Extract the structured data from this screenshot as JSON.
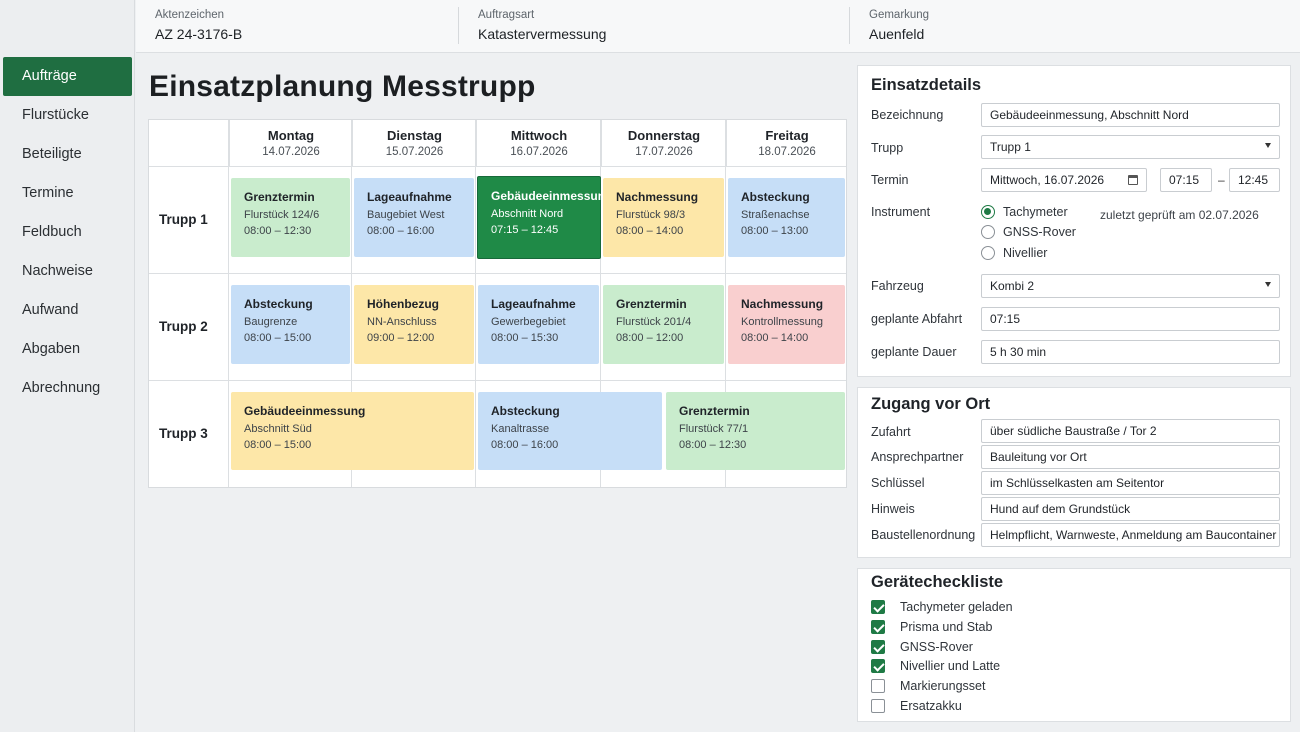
{
  "sidebar": {
    "items": [
      {
        "label": "Aufträge",
        "active": true
      },
      {
        "label": "Flurstücke"
      },
      {
        "label": "Beteiligte"
      },
      {
        "label": "Termine"
      },
      {
        "label": "Feldbuch"
      },
      {
        "label": "Nachweise"
      },
      {
        "label": "Aufwand"
      },
      {
        "label": "Abgaben"
      },
      {
        "label": "Abrechnung"
      }
    ]
  },
  "header": {
    "aktenzeichen": {
      "label": "Aktenzeichen",
      "value": "AZ 24-3176-B"
    },
    "auftragsart": {
      "label": "Auftragsart",
      "value": "Katastervermessung"
    },
    "gemarkung": {
      "label": "Gemarkung",
      "value": "Auenfeld"
    }
  },
  "planner": {
    "title": "Einsatzplanung Messtrupp",
    "days": [
      {
        "name": "Montag",
        "date": "14.07.2026"
      },
      {
        "name": "Dienstag",
        "date": "15.07.2026"
      },
      {
        "name": "Mittwoch",
        "date": "16.07.2026"
      },
      {
        "name": "Donnerstag",
        "date": "17.07.2026"
      },
      {
        "name": "Freitag",
        "date": "18.07.2026"
      }
    ],
    "rows": [
      {
        "label": "Trupp 1",
        "events": [
          {
            "title": "Grenztermin",
            "sub": "Flurstück 124/6",
            "time": "08:00 – 12:30",
            "color": "green"
          },
          {
            "title": "Lageaufnahme",
            "sub": "Baugebiet West",
            "time": "08:00 – 16:00",
            "color": "blue"
          },
          {
            "title": "Gebäudeeinmessung",
            "sub": "Abschnitt Nord",
            "time": "07:15 – 12:45",
            "color": "selected"
          },
          {
            "title": "Nachmessung",
            "sub": "Flurstück 98/3",
            "time": "08:00 – 14:00",
            "color": "yellow"
          },
          {
            "title": "Absteckung",
            "sub": "Straßenachse",
            "time": "08:00 – 13:00",
            "color": "blue"
          }
        ]
      },
      {
        "label": "Trupp 2",
        "events": [
          {
            "title": "Absteckung",
            "sub": "Baugrenze",
            "time": "08:00 – 15:00",
            "color": "blue"
          },
          {
            "title": "Höhenbezug",
            "sub": "NN-Anschluss",
            "time": "09:00 – 12:00",
            "color": "yellow"
          },
          {
            "title": "Lageaufnahme",
            "sub": "Gewerbegebiet",
            "time": "08:00 – 15:30",
            "color": "blue"
          },
          {
            "title": "Grenztermin",
            "sub": "Flurstück 201/4",
            "time": "08:00 – 12:00",
            "color": "green"
          },
          {
            "title": "Nachmessung",
            "sub": "Kontrollmessung",
            "time": "08:00 – 14:00",
            "color": "red"
          }
        ]
      },
      {
        "label": "Trupp 3",
        "events": [
          {
            "title": "Gebäudeeinmessung",
            "sub": "Abschnitt Süd",
            "time": "08:00 – 15:00",
            "color": "yellow"
          },
          {
            "title": "Absteckung",
            "sub": "Kanaltrasse",
            "time": "08:00 – 16:00",
            "color": "blue"
          },
          {
            "title": "Grenztermin",
            "sub": "Flurstück 77/1",
            "time": "08:00 – 12:30",
            "color": "green"
          }
        ]
      }
    ]
  },
  "details": {
    "title": "Einsatzdetails",
    "bezeichnung": {
      "label": "Bezeichnung",
      "value": "Gebäudeeinmessung, Abschnitt Nord"
    },
    "trupp": {
      "label": "Trupp",
      "value": "Trupp 1"
    },
    "termin": {
      "label": "Termin",
      "date": "Mittwoch, 16.07.2026",
      "from": "07:15",
      "sep": "–",
      "to": "12:45"
    },
    "instrument": {
      "label": "Instrument",
      "options": [
        "Tachymeter",
        "GNSS-Rover",
        "Nivellier"
      ],
      "selected": "Tachymeter",
      "note": "zuletzt geprüft am 02.07.2026"
    },
    "fahrzeug": {
      "label": "Fahrzeug",
      "value": "Kombi 2"
    },
    "abfahrt": {
      "label": "geplante Abfahrt",
      "value": "07:15"
    },
    "dauer": {
      "label": "geplante Dauer",
      "value": "5 h 30 min"
    }
  },
  "zugang": {
    "title": "Zugang vor Ort",
    "fields": [
      {
        "label": "Zufahrt",
        "value": "über südliche Baustraße / Tor 2"
      },
      {
        "label": "Ansprechpartner",
        "value": "Bauleitung vor Ort"
      },
      {
        "label": "Schlüssel",
        "value": "im Schlüsselkasten am Seitentor"
      },
      {
        "label": "Hinweis",
        "value": "Hund auf dem Grundstück"
      },
      {
        "label": "Baustellenordnung",
        "value": "Helmpflicht, Warnweste, Anmeldung am Baucontainer"
      }
    ]
  },
  "checkliste": {
    "title": "Gerätecheckliste",
    "items": [
      {
        "label": "Tachymeter geladen",
        "checked": true
      },
      {
        "label": "Prisma und Stab",
        "checked": true
      },
      {
        "label": "GNSS-Rover",
        "checked": true
      },
      {
        "label": "Nivellier und Latte",
        "checked": true
      },
      {
        "label": "Markierungsset",
        "checked": false
      },
      {
        "label": "Ersatzakku",
        "checked": false
      }
    ]
  },
  "colors": {
    "accent": "#1f6e41",
    "green": "#c9eccd",
    "blue": "#c6def7",
    "yellow": "#fde7a8",
    "red": "#f9cfcf",
    "selected": "#1f8a47"
  }
}
